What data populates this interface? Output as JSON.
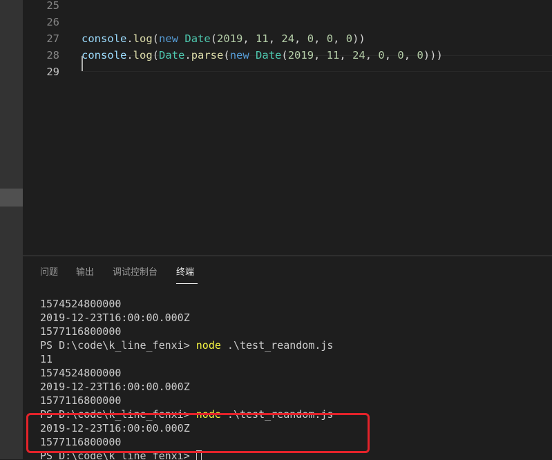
{
  "editor": {
    "lines": [
      {
        "num": "25",
        "code": []
      },
      {
        "num": "26",
        "code": []
      },
      {
        "num": "27",
        "code": [
          {
            "t": "console",
            "c": "var"
          },
          {
            "t": ".",
            "c": "p"
          },
          {
            "t": "log",
            "c": "fn"
          },
          {
            "t": "(",
            "c": "p"
          },
          {
            "t": "new",
            "c": "kw"
          },
          {
            "t": " ",
            "c": "p"
          },
          {
            "t": "Date",
            "c": "cls"
          },
          {
            "t": "(",
            "c": "p"
          },
          {
            "t": "2019",
            "c": "num"
          },
          {
            "t": ", ",
            "c": "p"
          },
          {
            "t": "11",
            "c": "num"
          },
          {
            "t": ", ",
            "c": "p"
          },
          {
            "t": "24",
            "c": "num"
          },
          {
            "t": ", ",
            "c": "p"
          },
          {
            "t": "0",
            "c": "num"
          },
          {
            "t": ", ",
            "c": "p"
          },
          {
            "t": "0",
            "c": "num"
          },
          {
            "t": ", ",
            "c": "p"
          },
          {
            "t": "0",
            "c": "num"
          },
          {
            "t": "))",
            "c": "p"
          }
        ]
      },
      {
        "num": "28",
        "code": [
          {
            "t": "console",
            "c": "var"
          },
          {
            "t": ".",
            "c": "p"
          },
          {
            "t": "log",
            "c": "fn"
          },
          {
            "t": "(",
            "c": "p"
          },
          {
            "t": "Date",
            "c": "cls"
          },
          {
            "t": ".",
            "c": "p"
          },
          {
            "t": "parse",
            "c": "fn"
          },
          {
            "t": "(",
            "c": "p"
          },
          {
            "t": "new",
            "c": "kw"
          },
          {
            "t": " ",
            "c": "p"
          },
          {
            "t": "Date",
            "c": "cls"
          },
          {
            "t": "(",
            "c": "p"
          },
          {
            "t": "2019",
            "c": "num"
          },
          {
            "t": ", ",
            "c": "p"
          },
          {
            "t": "11",
            "c": "num"
          },
          {
            "t": ", ",
            "c": "p"
          },
          {
            "t": "24",
            "c": "num"
          },
          {
            "t": ", ",
            "c": "p"
          },
          {
            "t": "0",
            "c": "num"
          },
          {
            "t": ", ",
            "c": "p"
          },
          {
            "t": "0",
            "c": "num"
          },
          {
            "t": ", ",
            "c": "p"
          },
          {
            "t": "0",
            "c": "num"
          },
          {
            "t": ")))",
            "c": "p"
          }
        ]
      },
      {
        "num": "29",
        "code": [],
        "active": true
      }
    ]
  },
  "panel": {
    "tabs": [
      {
        "label": "问题",
        "active": false
      },
      {
        "label": "输出",
        "active": false
      },
      {
        "label": "调试控制台",
        "active": false
      },
      {
        "label": "终端",
        "active": true
      }
    ],
    "terminal": [
      {
        "text": "1574524800000"
      },
      {
        "text": "2019-12-23T16:00:00.000Z"
      },
      {
        "text": "1577116800000"
      },
      {
        "prompt": "PS D:\\code\\k_line_fenxi> ",
        "cmd": "node",
        "args": " .\\test_reandom.js"
      },
      {
        "text": "11"
      },
      {
        "text": "1574524800000"
      },
      {
        "text": "2019-12-23T16:00:00.000Z"
      },
      {
        "text": "1577116800000"
      },
      {
        "prompt": "PS D:\\code\\k_line_fenxi> ",
        "cmd": "node",
        "args": " .\\test_reandom.js"
      },
      {
        "text": "2019-12-23T16:00:00.000Z"
      },
      {
        "text": "1577116800000"
      },
      {
        "prompt": "PS D:\\code\\k_line_fenxi> ",
        "cursor": true
      }
    ]
  },
  "colors": {
    "keyword": "#569cd6",
    "class": "#4ec9b0",
    "function": "#dcdcaa",
    "variable": "#9cdcfe",
    "number": "#b5cea8",
    "command": "#f5f543",
    "highlight_box": "#e3232a"
  }
}
